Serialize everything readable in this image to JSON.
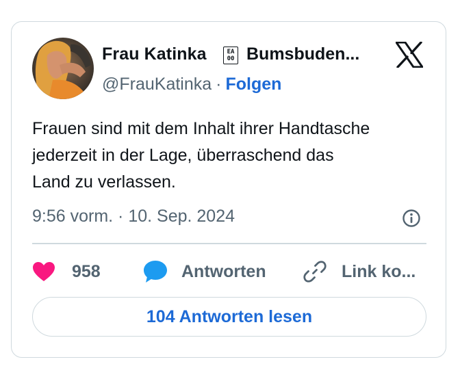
{
  "author": {
    "display_name": "Frau Katinka",
    "badge_glyph": "EA 00",
    "display_name_rest": "Bumsbuden...",
    "handle": "@FrauKatinka",
    "separator": "·",
    "follow_label": "Folgen"
  },
  "tweet": {
    "text": "Frauen sind mit dem Inhalt ihrer Handtasche\njederzeit in der Lage, überraschend das\nLand zu verlassen.",
    "timestamp": "9:56 vorm. · 10. Sep. 2024"
  },
  "actions": {
    "like_count": "958",
    "reply_label": "Antworten",
    "link_label": "Link ko..."
  },
  "footer": {
    "read_replies_label": "104 Antworten lesen"
  },
  "icons": {
    "brand": "x-logo-icon",
    "info": "info-icon",
    "like": "heart-icon",
    "reply": "speech-bubble-icon",
    "link": "link-icon"
  },
  "colors": {
    "text": "#0f1419",
    "secondary_text": "#536471",
    "link_blue": "#1d6ad6",
    "heart_pink": "#f91880",
    "reply_blue": "#1d9bf0",
    "border": "#cfd9de"
  }
}
